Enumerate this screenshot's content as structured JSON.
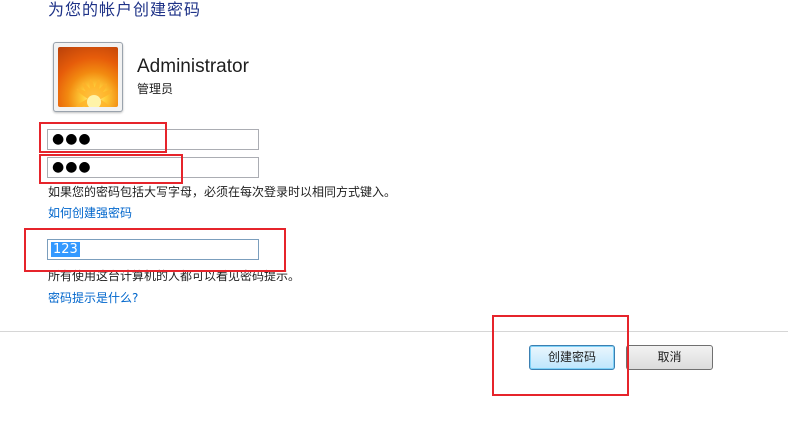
{
  "page": {
    "heading": "为您的帐户创建密码"
  },
  "user": {
    "name": "Administrator",
    "role": "管理员",
    "avatar_icon": "flower-avatar-icon"
  },
  "form": {
    "password": "●●●",
    "confirm_password": "●●●",
    "caps_note": "如果您的密码包括大写字母，必须在每次登录时以相同方式键入。",
    "strong_password_link": "如何创建强密码",
    "hint_value": "123",
    "hint_note": "所有使用这台计算机的人都可以看见密码提示。",
    "hint_link": "密码提示是什么?"
  },
  "buttons": {
    "create": "创建密码",
    "cancel": "取消"
  },
  "colors": {
    "heading": "#1e3287",
    "link": "#0066cc",
    "annotation": "#e6242b",
    "selection": "#3399ff"
  }
}
